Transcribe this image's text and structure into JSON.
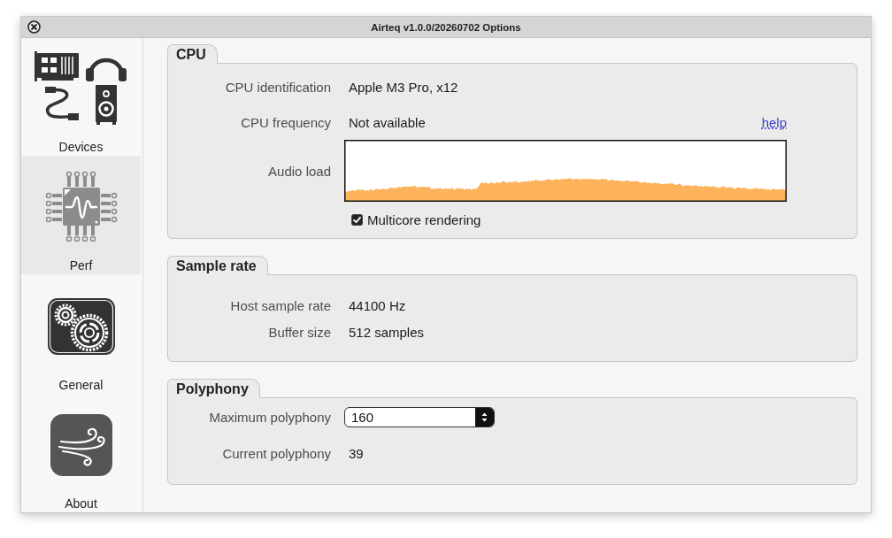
{
  "window": {
    "title": "Airteq v1.0.0/20260702 Options"
  },
  "sidebar": {
    "items": [
      {
        "label": "Devices",
        "selected": false
      },
      {
        "label": "Perf",
        "selected": true
      },
      {
        "label": "General",
        "selected": false
      },
      {
        "label": "About",
        "selected": false
      }
    ]
  },
  "sections": [
    {
      "title": "CPU",
      "rows": [
        {
          "kind": "text",
          "label": "CPU identification",
          "value": "Apple M3 Pro, x12"
        },
        {
          "kind": "text",
          "label": "CPU frequency",
          "value": "Not available",
          "link": "help"
        },
        {
          "kind": "graph",
          "label": "Audio load"
        },
        {
          "kind": "checkbox",
          "label": "Multicore rendering",
          "checked": true
        }
      ]
    },
    {
      "title": "Sample rate",
      "rows": [
        {
          "kind": "text",
          "label": "Host sample rate",
          "value": "44100 Hz"
        },
        {
          "kind": "text",
          "label": "Buffer size",
          "value": "512 samples"
        }
      ]
    },
    {
      "title": "Polyphony",
      "rows": [
        {
          "kind": "spin",
          "label": "Maximum polyphony",
          "value": "160"
        },
        {
          "kind": "text",
          "label": "Current polyphony",
          "value": "39"
        }
      ]
    }
  ]
}
